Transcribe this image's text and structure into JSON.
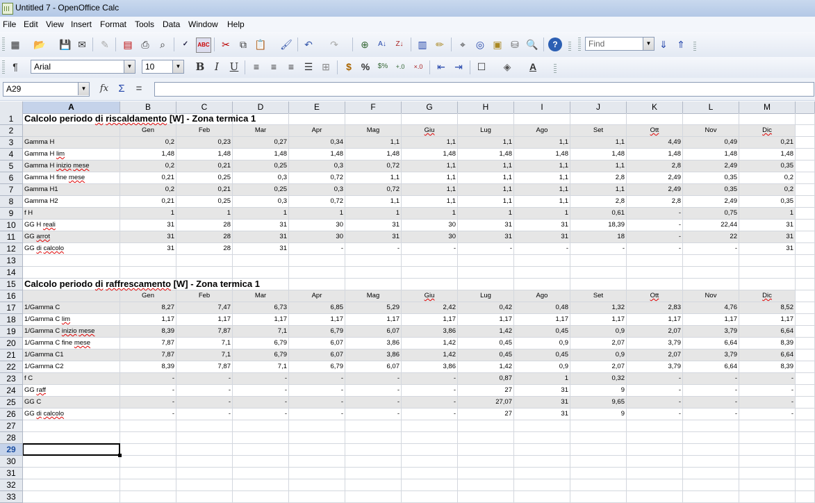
{
  "window": {
    "title": "Untitled 7 - OpenOffice Calc"
  },
  "menu": [
    "File",
    "Edit",
    "View",
    "Insert",
    "Format",
    "Tools",
    "Data",
    "Window",
    "Help"
  ],
  "toolbar": {
    "find_placeholder": "Find",
    "font_name": "Arial",
    "font_size": "10",
    "bold_label": "B",
    "italic_label": "I",
    "underline_label": "U",
    "percent_label": "%",
    "icons": [
      "new-icon",
      "open-icon",
      "save-icon",
      "email-icon",
      "edit-file-icon",
      "export-pdf-icon",
      "print-icon",
      "page-preview-icon",
      "spellcheck-icon",
      "autospellcheck-icon",
      "cut-icon",
      "copy-icon",
      "paste-icon",
      "clone-format-icon",
      "undo-icon",
      "redo-icon",
      "hyperlink-icon",
      "sort-ascending-icon",
      "sort-descending-icon",
      "chart-icon",
      "draw-functions-icon",
      "find-replace-icon",
      "navigator-icon",
      "gallery-icon",
      "data-sources-icon",
      "zoom-icon",
      "help-icon"
    ]
  },
  "formula_bar": {
    "name_box": "A29",
    "function_wizard": "fx",
    "sum": "Σ",
    "equals": "=",
    "value": ""
  },
  "columns": [
    "A",
    "B",
    "C",
    "D",
    "E",
    "F",
    "G",
    "H",
    "I",
    "J",
    "K",
    "L",
    "M"
  ],
  "selected_cell": "A29",
  "months": [
    "Gen",
    "Feb",
    "Mar",
    "Apr",
    "Mag",
    "Giu",
    "Lug",
    "Ago",
    "Set",
    "Ott",
    "Nov",
    "Dic"
  ],
  "rows": {
    "1": {
      "title": "Calcolo periodo di riscaldamento [W] - Zona termica 1"
    },
    "3": {
      "label": "Gamma H",
      "values": [
        "0,2",
        "0,23",
        "0,27",
        "0,34",
        "1,1",
        "1,1",
        "1,1",
        "1,1",
        "1,1",
        "4,49",
        "0,49",
        "0,21"
      ]
    },
    "4": {
      "label": "Gamma H lim",
      "values": [
        "1,48",
        "1,48",
        "1,48",
        "1,48",
        "1,48",
        "1,48",
        "1,48",
        "1,48",
        "1,48",
        "1,48",
        "1,48",
        "1,48"
      ]
    },
    "5": {
      "label": "Gamma H inizio mese",
      "values": [
        "0,2",
        "0,21",
        "0,25",
        "0,3",
        "0,72",
        "1,1",
        "1,1",
        "1,1",
        "1,1",
        "2,8",
        "2,49",
        "0,35"
      ]
    },
    "6": {
      "label": "Gamma H fine mese",
      "values": [
        "0,21",
        "0,25",
        "0,3",
        "0,72",
        "1,1",
        "1,1",
        "1,1",
        "1,1",
        "2,8",
        "2,49",
        "0,35",
        "0,2"
      ]
    },
    "7": {
      "label": "Gamma H1",
      "values": [
        "0,2",
        "0,21",
        "0,25",
        "0,3",
        "0,72",
        "1,1",
        "1,1",
        "1,1",
        "1,1",
        "2,49",
        "0,35",
        "0,2"
      ]
    },
    "8": {
      "label": "Gamma H2",
      "values": [
        "0,21",
        "0,25",
        "0,3",
        "0,72",
        "1,1",
        "1,1",
        "1,1",
        "1,1",
        "2,8",
        "2,8",
        "2,49",
        "0,35"
      ]
    },
    "9": {
      "label": "f H",
      "values": [
        "1",
        "1",
        "1",
        "1",
        "1",
        "1",
        "1",
        "1",
        "0,61",
        "-",
        "0,75",
        "1"
      ]
    },
    "10": {
      "label": "GG H reali",
      "values": [
        "31",
        "28",
        "31",
        "30",
        "31",
        "30",
        "31",
        "31",
        "18,39",
        "-",
        "22,44",
        "31"
      ]
    },
    "11": {
      "label": "GG arrot",
      "values": [
        "31",
        "28",
        "31",
        "30",
        "31",
        "30",
        "31",
        "31",
        "18",
        "-",
        "22",
        "31"
      ]
    },
    "12": {
      "label": "GG di calcolo",
      "values": [
        "31",
        "28",
        "31",
        "-",
        "-",
        "-",
        "-",
        "-",
        "-",
        "-",
        "-",
        "31"
      ]
    },
    "15": {
      "title": "Calcolo periodo di raffrescamento [W] - Zona termica 1"
    },
    "17": {
      "label": "1/Gamma C",
      "values": [
        "8,27",
        "7,47",
        "6,73",
        "6,85",
        "5,29",
        "2,42",
        "0,42",
        "0,48",
        "1,32",
        "2,83",
        "4,76",
        "8,52"
      ]
    },
    "18": {
      "label": "1/Gamma C lim",
      "values": [
        "1,17",
        "1,17",
        "1,17",
        "1,17",
        "1,17",
        "1,17",
        "1,17",
        "1,17",
        "1,17",
        "1,17",
        "1,17",
        "1,17"
      ]
    },
    "19": {
      "label": "1/Gamma C inizio mese",
      "values": [
        "8,39",
        "7,87",
        "7,1",
        "6,79",
        "6,07",
        "3,86",
        "1,42",
        "0,45",
        "0,9",
        "2,07",
        "3,79",
        "6,64"
      ]
    },
    "20": {
      "label": "1/Gamma C fine mese",
      "values": [
        "7,87",
        "7,1",
        "6,79",
        "6,07",
        "3,86",
        "1,42",
        "0,45",
        "0,9",
        "2,07",
        "3,79",
        "6,64",
        "8,39"
      ]
    },
    "21": {
      "label": "1/Gamma C1",
      "values": [
        "7,87",
        "7,1",
        "6,79",
        "6,07",
        "3,86",
        "1,42",
        "0,45",
        "0,45",
        "0,9",
        "2,07",
        "3,79",
        "6,64"
      ]
    },
    "22": {
      "label": "1/Gamma C2",
      "values": [
        "8,39",
        "7,87",
        "7,1",
        "6,79",
        "6,07",
        "3,86",
        "1,42",
        "0,9",
        "2,07",
        "3,79",
        "6,64",
        "8,39"
      ]
    },
    "23": {
      "label": "f C",
      "values": [
        "-",
        "-",
        "-",
        "-",
        "-",
        "-",
        "0,87",
        "1",
        "0,32",
        "-",
        "-",
        "-"
      ]
    },
    "24": {
      "label": "GG raff",
      "values": [
        "-",
        "-",
        "-",
        "-",
        "-",
        "-",
        "27",
        "31",
        "9",
        "-",
        "-",
        "-"
      ]
    },
    "25": {
      "label": "GG C",
      "values": [
        "-",
        "-",
        "-",
        "-",
        "-",
        "-",
        "27,07",
        "31",
        "9,65",
        "-",
        "-",
        "-"
      ]
    },
    "26": {
      "label": "GG di calcolo",
      "values": [
        "-",
        "-",
        "-",
        "-",
        "-",
        "-",
        "27",
        "31",
        "9",
        "-",
        "-",
        "-"
      ]
    }
  },
  "header_rows": [
    "2",
    "16"
  ],
  "gray_rows": [
    "2",
    "3",
    "5",
    "7",
    "9",
    "11",
    "16",
    "17",
    "19",
    "21",
    "23",
    "25"
  ],
  "colors": {
    "header_band": "#e6e6e6",
    "selection_header": "#c5d3ea",
    "grid_line": "#d3d7de"
  }
}
